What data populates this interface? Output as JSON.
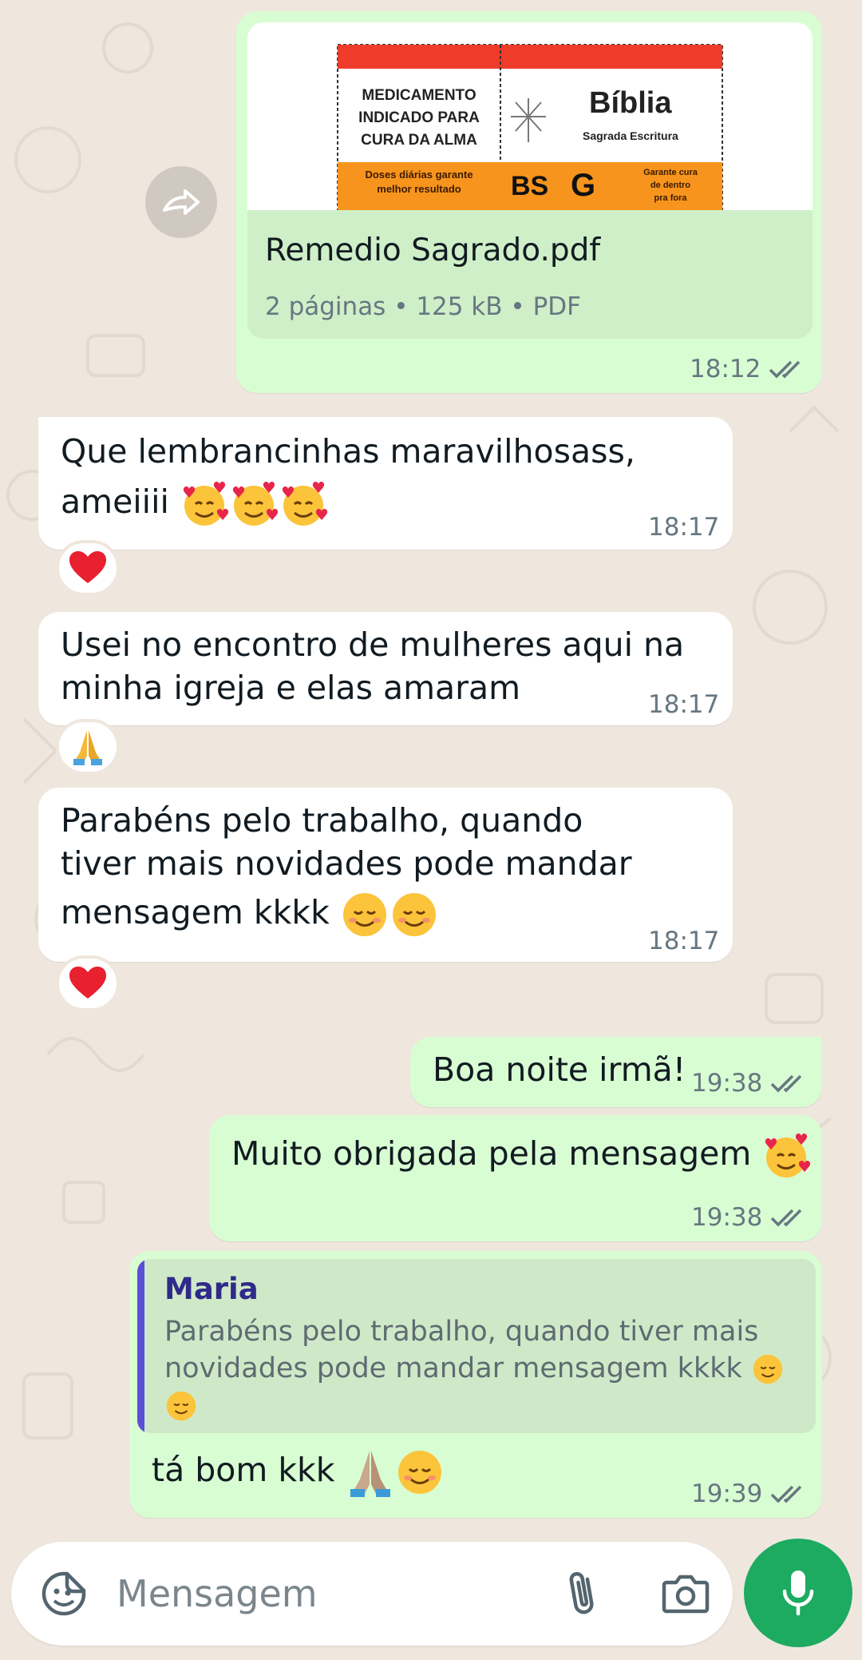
{
  "messages": {
    "doc": {
      "preview_left_line1": "MEDICAMENTO",
      "preview_left_line2": "INDICADO PARA",
      "preview_left_line3": "CURA DA ALMA",
      "preview_title": "Bíblia",
      "preview_subtitle": "Sagrada Escritura",
      "preview_orange_left_1": "Doses diárias garante",
      "preview_orange_left_2": "melhor resultado",
      "preview_bs": "BS",
      "preview_g": "G",
      "preview_orange_right_1": "Garante cura",
      "preview_orange_right_2": "de dentro",
      "preview_orange_right_3": "pra fora",
      "name": "Remedio Sagrado.pdf",
      "meta": "2 páginas • 125 kB • PDF",
      "time": "18:12"
    },
    "m1": {
      "line1": "Que lembrancinhas maravilhosass,",
      "line2": "ameiiii",
      "time": "18:17",
      "reaction": "heart"
    },
    "m2": {
      "line1": "Usei no encontro de mulheres aqui na",
      "line2": "minha igreja e elas amaram",
      "time": "18:17",
      "reaction": "praying-hands"
    },
    "m3": {
      "line1": "Parabéns pelo trabalho, quando",
      "line2": "tiver mais novidades pode mandar",
      "line3": "mensagem kkkk",
      "time": "18:17",
      "reaction": "heart"
    },
    "m4": {
      "text": "Boa noite irmã!",
      "time": "19:38"
    },
    "m5": {
      "text": "Muito obrigada pela mensagem",
      "time": "19:38"
    },
    "m6": {
      "quote_author": "Maria",
      "quote_text": "Parabéns pelo trabalho, quando tiver mais novidades pode mandar mensagem kkkk",
      "text": "tá bom kkk",
      "time": "19:39"
    }
  },
  "composer": {
    "placeholder": "Mensagem"
  },
  "colors": {
    "outgoing": "#d9fdd3",
    "incoming": "#ffffff",
    "mic": "#1daa61",
    "quote_bar": "#5b4fd6",
    "ticks": "#667781"
  }
}
